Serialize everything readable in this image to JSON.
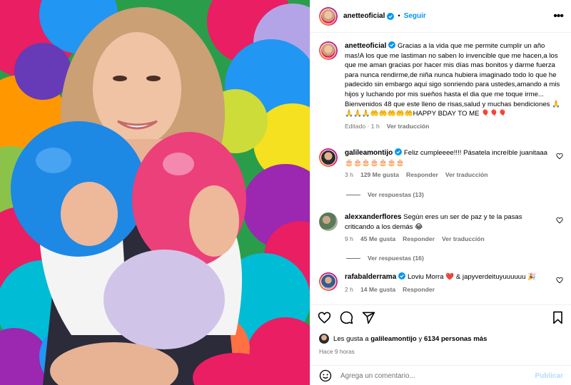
{
  "header": {
    "username": "anetteoficial",
    "dot": "•",
    "follow_label": "Seguir",
    "more_icon": "more-options-icon"
  },
  "caption": {
    "username": "anetteoficial",
    "text": "Gracias a la vida que me permite cumplir un año mas!A los que me lastiman no saben lo invencible que me hacen,a los que me aman gracias por hacer mis días mas bonitos y darme fuerza para nunca rendirme,de niña nunca hubiera imaginado todo lo que he padecido sin embargo aqui sigo sonriendo para ustedes,amando a mis hijos y luchando por mis sueños hasta el dia que me toque irme... Bienvenidos 48 que este lleno de risas,salud y muchas bendiciones 🙏🙏🙏🙏🤲🤲🤲🤲🤲HAPPY BDAY TO ME 🎈🎈🎈",
    "edited": "Editado · 1 h",
    "translate": "Ver traducción"
  },
  "comments": [
    {
      "username": "galileamontijo",
      "verified": true,
      "text": "Feliz cumpleeee!!!! Pásatela increíble juanitaaa 🎂🎂🎂🎂🎂🎂🎂",
      "time": "3 h",
      "likes": "129 Me gusta",
      "reply": "Responder",
      "translate": "Ver traducción",
      "view_replies": "Ver respuestas (13)"
    },
    {
      "username": "alexxanderflores",
      "verified": false,
      "text": "Según eres un ser de paz y te la pasas criticando a los demás 😂",
      "time": "9 h",
      "likes": "45 Me gusta",
      "reply": "Responder",
      "translate": "Ver traducción",
      "view_replies": "Ver respuestas (16)"
    },
    {
      "username": "rafabalderrama",
      "verified": true,
      "text": "Loviu Morra ❤️ & japyverdeituyuuuuuu 🎉",
      "time": "2 h",
      "likes": "14 Me gusta",
      "reply": "Responder"
    }
  ],
  "footer": {
    "likes_prefix": "Les gusta a",
    "likes_user": "galileamontijo",
    "likes_middle": "y",
    "likes_count": "6134 personas más",
    "posted": "Hace 9 horas",
    "comment_placeholder": "Agrega un comentario...",
    "publish_label": "Publicar"
  },
  "colors": {
    "accent": "#0095f6",
    "muted": "#737373",
    "border": "#efefef",
    "verified": "#0095f6"
  },
  "icons": [
    "heart-icon",
    "comment-icon",
    "share-icon",
    "bookmark-icon",
    "emoji-icon",
    "verified-icon"
  ]
}
